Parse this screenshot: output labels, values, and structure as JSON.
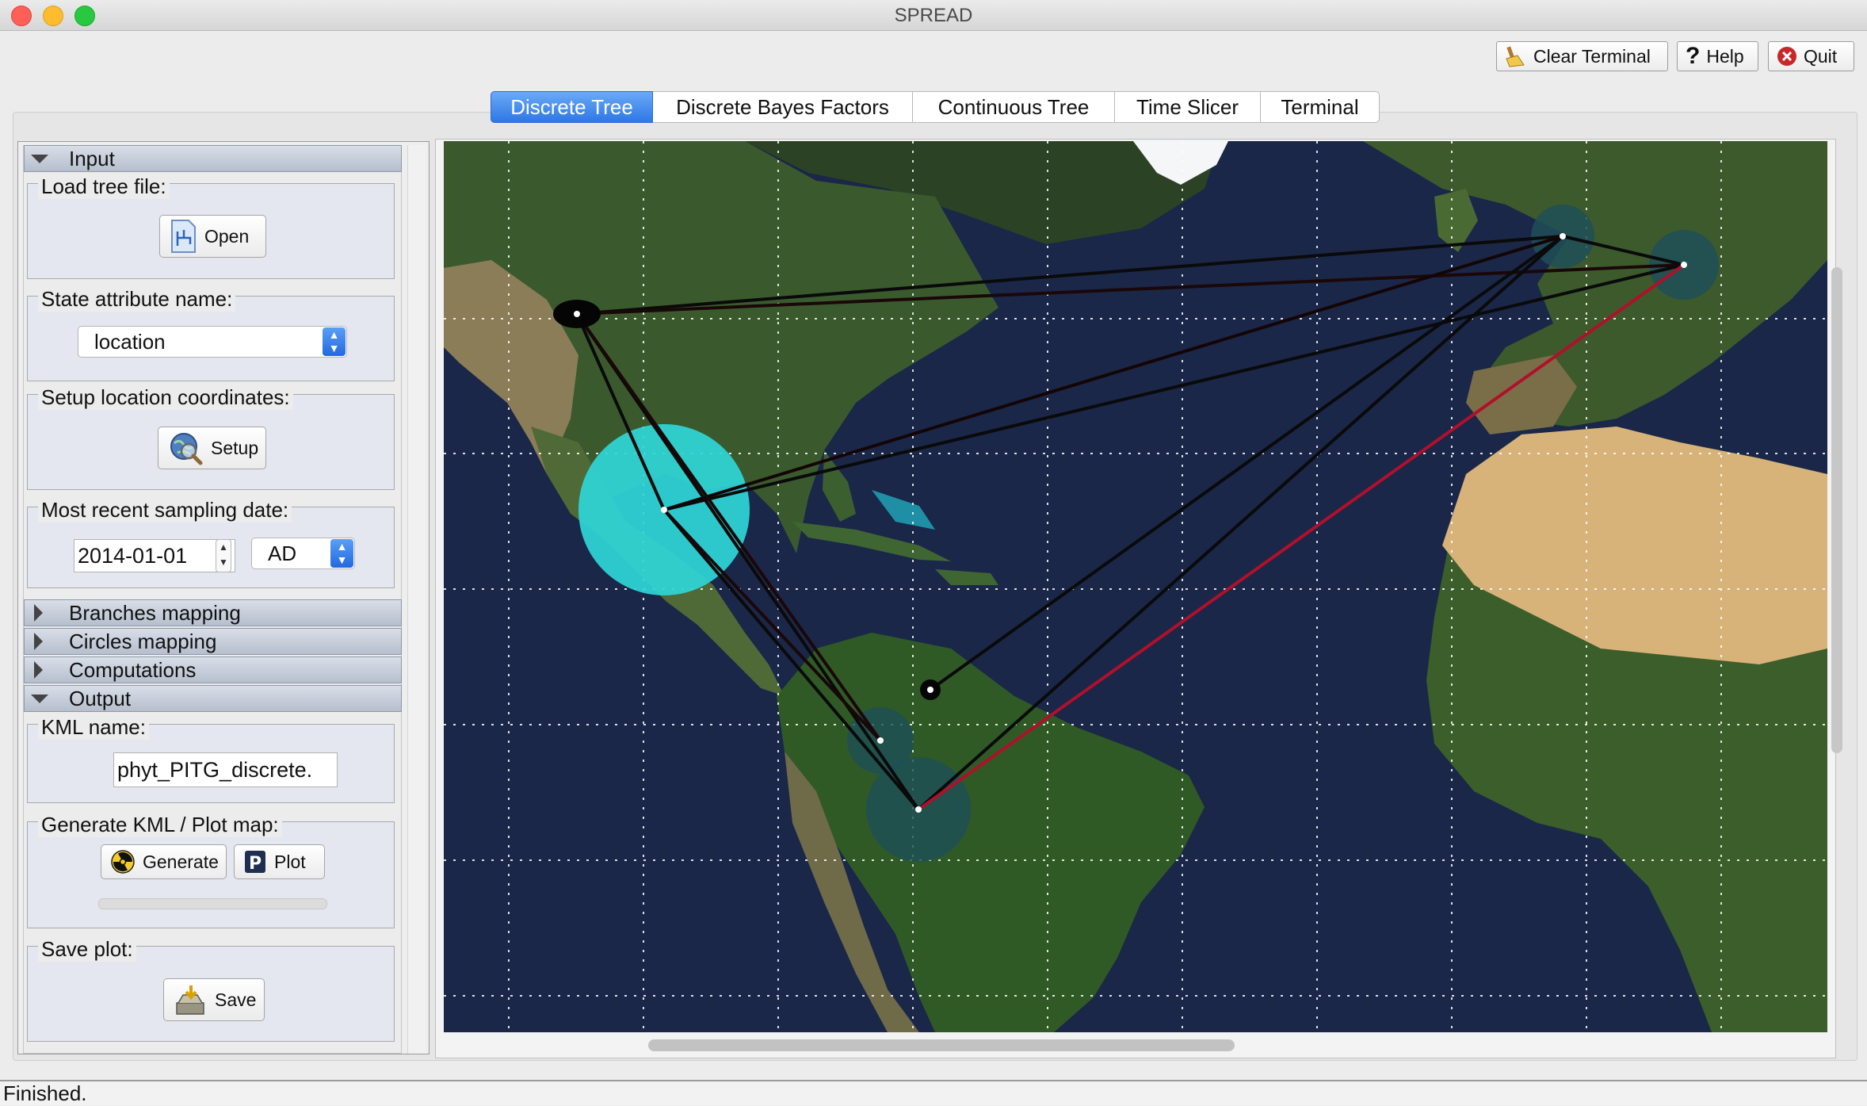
{
  "window": {
    "title": "SPREAD"
  },
  "toolbar": {
    "clear_terminal": "Clear Terminal",
    "help": "Help",
    "quit": "Quit"
  },
  "tabs": [
    {
      "label": "Discrete Tree",
      "active": true
    },
    {
      "label": "Discrete Bayes Factors",
      "active": false
    },
    {
      "label": "Continuous Tree",
      "active": false
    },
    {
      "label": "Time Slicer",
      "active": false
    },
    {
      "label": "Terminal",
      "active": false
    }
  ],
  "panel": {
    "input_header": "Input",
    "load_tree_label": "Load tree file:",
    "open_button": "Open",
    "state_attribute_label": "State attribute name:",
    "state_attribute_value": "location",
    "setup_location_label": "Setup location coordinates:",
    "setup_button": "Setup",
    "sampling_date_label": "Most recent sampling date:",
    "sampling_date_value": "2014-01-01",
    "era_value": "AD",
    "branches_header": "Branches mapping",
    "circles_header": "Circles mapping",
    "computations_header": "Computations",
    "output_header": "Output",
    "kml_name_label": "KML name:",
    "kml_name_value": "phyt_PITG_discrete.",
    "generate_label": "Generate KML / Plot map:",
    "generate_button": "Generate",
    "plot_button": "Plot",
    "save_plot_label": "Save plot:",
    "save_button": "Save"
  },
  "colors": {
    "accent": "#2e77e6",
    "ocean": "#1a2748",
    "circle_large": "#2fd6d8",
    "circle_dark": "#1e4f57",
    "branch_black": "#0a0a0a",
    "branch_red": "#b0102a"
  },
  "status": {
    "text": "Finished."
  }
}
